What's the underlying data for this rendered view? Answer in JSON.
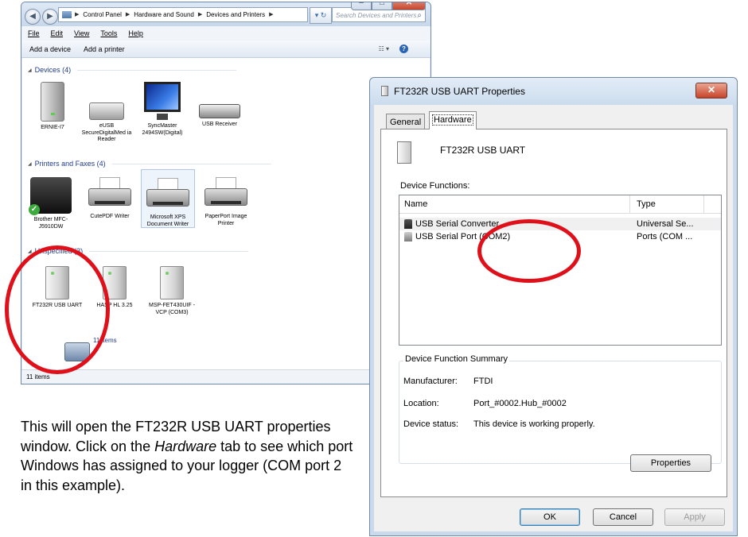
{
  "explorer": {
    "breadcrumb": [
      "Control Panel",
      "Hardware and Sound",
      "Devices and Printers"
    ],
    "search_placeholder": "Search Devices and Printers",
    "menu": [
      "File",
      "Edit",
      "View",
      "Tools",
      "Help"
    ],
    "commands": [
      "Add a device",
      "Add a printer"
    ],
    "groups": {
      "devices": "Devices (4)",
      "printers": "Printers and Faxes (4)",
      "unspecified": "Unspecified (3)"
    },
    "devices": [
      {
        "label": "ERNIE-I7",
        "icon": "computer-tower-icon"
      },
      {
        "label": "eUSB SecureDigitalMed ia Reader",
        "icon": "card-reader-icon"
      },
      {
        "label": "SyncMaster 2494SW(Digital)",
        "icon": "monitor-icon"
      },
      {
        "label": "USB Receiver",
        "icon": "keyboard-icon"
      }
    ],
    "printers": [
      {
        "label": "Brother MFC-J5910DW",
        "icon": "multifunction-printer-icon"
      },
      {
        "label": "CutePDF Writer",
        "icon": "printer-icon"
      },
      {
        "label": "Microsoft XPS Document Writer",
        "icon": "printer-icon"
      },
      {
        "label": "PaperPort Image Printer",
        "icon": "printer-icon"
      }
    ],
    "unspecified": [
      {
        "label": "FT232R USB UART",
        "icon": "usb-device-icon"
      },
      {
        "label": "HASP HL 3.25",
        "icon": "usb-device-icon"
      },
      {
        "label": "MSP-FET430UIF - VCP (COM3)",
        "icon": "usb-device-icon"
      }
    ],
    "details_count": "11 items",
    "status": "11 items"
  },
  "dialog": {
    "title": "FT232R USB UART Properties",
    "tabs": [
      "General",
      "Hardware"
    ],
    "active_tab": "Hardware",
    "device_name": "FT232R USB UART",
    "functions_label": "Device Functions:",
    "columns": [
      "Name",
      "Type"
    ],
    "rows": [
      {
        "name": "USB Serial Converter",
        "type": "Universal Se..."
      },
      {
        "name": "USB Serial Port (COM2)",
        "type": "Ports (COM ..."
      }
    ],
    "summary_title": "Device Function Summary",
    "summary": {
      "manufacturer_label": "Manufacturer:",
      "manufacturer": "FTDI",
      "location_label": "Location:",
      "location": "Port_#0002.Hub_#0002",
      "status_label": "Device status:",
      "status": "This device is working properly."
    },
    "properties_button": "Properties",
    "ok": "OK",
    "cancel": "Cancel",
    "apply": "Apply"
  },
  "caption": {
    "before": "This will open the FT232R USB UART properties window. Click on the ",
    "emph": "Hardware",
    "after": " tab to see which port Windows has assigned to your logger (COM port 2 in this example)."
  },
  "colors": {
    "highlight_ring": "#e0101a",
    "group_header": "#1e3a8c"
  }
}
